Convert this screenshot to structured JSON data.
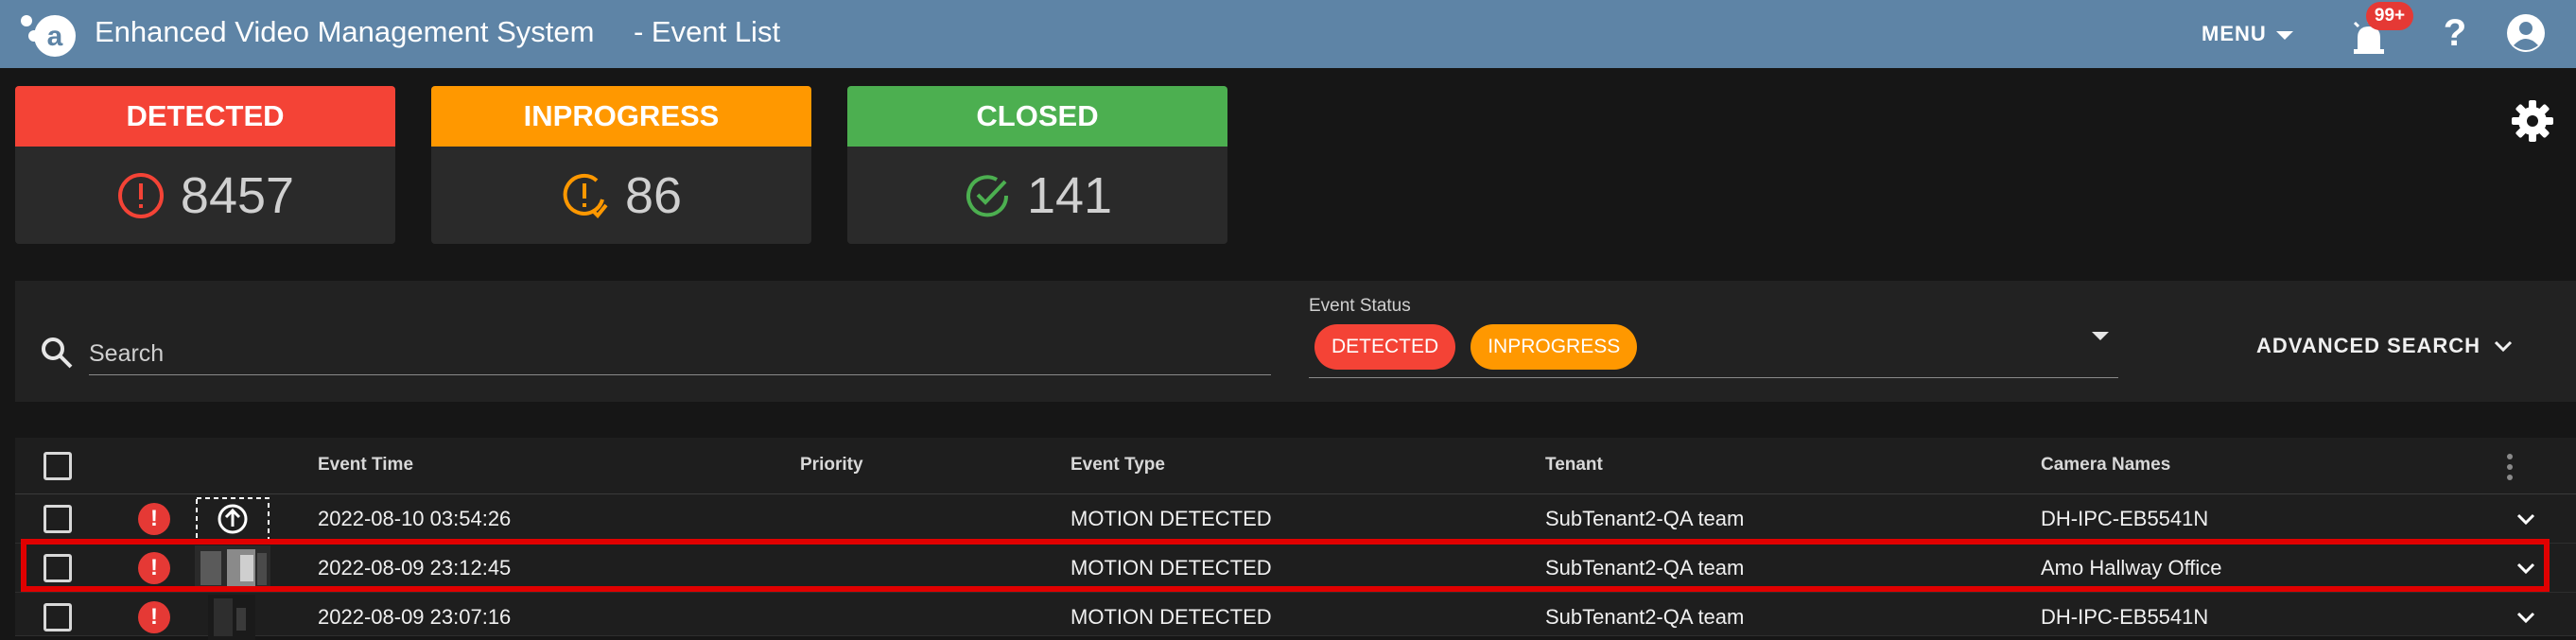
{
  "app": {
    "title": "Enhanced Video Management System",
    "page_title": "- Event List"
  },
  "topbar": {
    "menu_label": "MENU",
    "alarm_badge": "99+",
    "help_label": "?"
  },
  "status_cards": [
    {
      "label": "DETECTED",
      "count": "8457",
      "color": "#f44336",
      "icon": "alert-circle-icon"
    },
    {
      "label": "INPROGRESS",
      "count": "86",
      "color": "#ff9800",
      "icon": "progress-clock-icon"
    },
    {
      "label": "CLOSED",
      "count": "141",
      "color": "#4caf50",
      "icon": "check-circle-icon"
    }
  ],
  "filters": {
    "search_placeholder": "Search",
    "event_status_label": "Event Status",
    "chips": [
      {
        "label": "DETECTED",
        "color": "#f44336"
      },
      {
        "label": "INPROGRESS",
        "color": "#ff9800"
      }
    ],
    "advanced_search_label": "ADVANCED SEARCH"
  },
  "table": {
    "columns": [
      "Event Time",
      "Priority",
      "Event Type",
      "Tenant",
      "Camera Names"
    ],
    "rows": [
      {
        "event_time": "2022-08-10 03:54:26",
        "event_type": "MOTION DETECTED",
        "tenant": "SubTenant2-QA team",
        "camera": "DH-IPC-EB5541N",
        "thumbnail": "upload-placeholder-icon"
      },
      {
        "event_time": "2022-08-09 23:12:45",
        "event_type": "MOTION DETECTED",
        "tenant": "SubTenant2-QA team",
        "camera": "Amo Hallway Office",
        "thumbnail": "camera-snapshot"
      },
      {
        "event_time": "2022-08-09 23:07:16",
        "event_type": "MOTION DETECTED",
        "tenant": "SubTenant2-QA team",
        "camera": "DH-IPC-EB5541N",
        "thumbnail": "camera-snapshot"
      }
    ]
  },
  "colors": {
    "topbar": "#5e84a6",
    "highlight": "#e00000",
    "background": "#161616"
  }
}
